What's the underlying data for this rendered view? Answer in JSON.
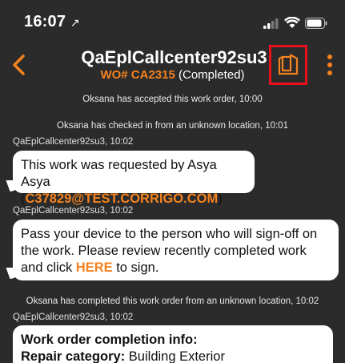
{
  "status_bar": {
    "time": "16:07",
    "location_arrow": "↗"
  },
  "nav": {
    "title": "QaEplCallcenter92su3",
    "wo_label": "WO# CA2315",
    "status": "(Completed)"
  },
  "feed": {
    "sys1": "Oksana has accepted this work order, 10:00",
    "sys2": "Oksana has checked in from an unknown location, 10:01",
    "meta1": "QaEplCallcenter92su3, 10:02",
    "msg1_text": "This work was requested by Asya Asya",
    "msg1_paren_open": "(",
    "msg1_email": "C37829@TEST.CORRIGO.COM",
    "msg1_paren_close": ")",
    "meta2": "QaEplCallcenter92su3, 10:02",
    "msg2_line1": "Pass your device to the person who will sign-off on",
    "msg2_line2": "the work. Please review recently completed work",
    "msg2_line3_pre": "and click ",
    "msg2_here": "HERE",
    "msg2_line3_post": " to sign.",
    "sys3": "Oksana has completed this work order from an unknown location, 10:02",
    "meta3": "QaEplCallcenter92su3, 10:02",
    "msg3_heading": "Work order completion info:",
    "msg3_cat_label": "Repair category:",
    "msg3_cat_value": " Building Exterior"
  },
  "colors": {
    "accent": "#f4821f",
    "background": "#2b2b2b",
    "highlight_box": "#e8111b"
  }
}
